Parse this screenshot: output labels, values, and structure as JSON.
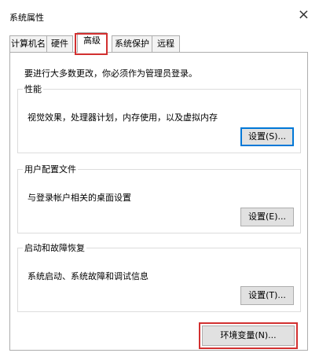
{
  "window": {
    "title": "系统属性",
    "close_glyph": "×"
  },
  "tabs": [
    {
      "label": "计算机名"
    },
    {
      "label": "硬件"
    },
    {
      "label": "高级",
      "active": true
    },
    {
      "label": "系统保护"
    },
    {
      "label": "远程"
    }
  ],
  "panel": {
    "notice": "要进行大多数更改，你必须作为管理员登录。",
    "groups": {
      "performance": {
        "title": "性能",
        "desc": "视觉效果，处理器计划，内存使用，以及虚拟内存",
        "button": "设置(S)..."
      },
      "profiles": {
        "title": "用户配置文件",
        "desc": "与登录帐户相关的桌面设置",
        "button": "设置(E)..."
      },
      "startup": {
        "title": "启动和故障恢复",
        "desc": "系统启动、系统故障和调试信息",
        "button": "设置(T)..."
      }
    },
    "env_button": "环境变量(N)..."
  },
  "colors": {
    "highlight": "#d23030",
    "focus": "#0078d7"
  }
}
